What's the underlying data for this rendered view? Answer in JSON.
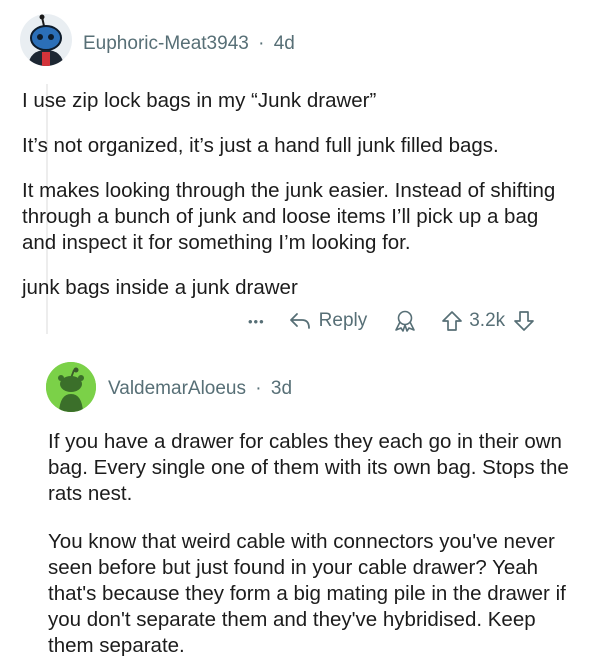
{
  "comments": [
    {
      "author": "Euphoric-Meat3943",
      "separator": "·",
      "age": "4d",
      "paragraphs": [
        "I use zip lock bags in my “Junk drawer”",
        "It’s not organized, it’s just a hand full junk filled bags.",
        "It makes looking through the junk easier.  Instead of shifting through a bunch of junk and loose items I’ll pick up a bag and inspect it for something I’m looking for.",
        "junk bags inside a junk drawer"
      ],
      "actions": {
        "more": "•••",
        "reply_label": "Reply",
        "score": "3.2k"
      },
      "icons": [
        "more-icon",
        "reply-arrow-icon",
        "award-icon",
        "upvote-icon",
        "downvote-icon"
      ],
      "avatar_color": "#2b6fb8"
    },
    {
      "author": "ValdemarAloeus",
      "separator": "·",
      "age": "3d",
      "paragraphs": [
        "If you have a drawer for cables they each go in their own bag. Every single one of them with its own bag. Stops the rats nest.",
        "You know that weird cable with connectors you've never seen before but just found in your cable drawer? Yeah that's because they form a big mating pile in the drawer if you don't separate them and they've hybridised. Keep them separate."
      ],
      "avatar_color": "#7bd148"
    }
  ],
  "colors": {
    "thread_line": "#e6e6e6",
    "meta_text": "#576f76",
    "body_text": "#1c1c1c"
  }
}
